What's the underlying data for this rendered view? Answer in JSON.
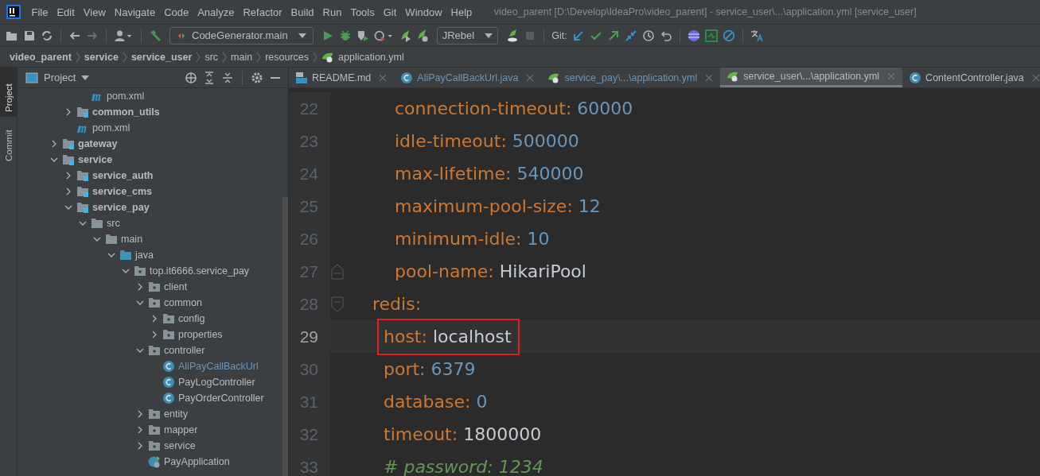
{
  "menu": [
    "File",
    "Edit",
    "View",
    "Navigate",
    "Code",
    "Analyze",
    "Refactor",
    "Build",
    "Run",
    "Tools",
    "Git",
    "Window",
    "Help"
  ],
  "window": {
    "title": "video_parent [D:\\Develop\\IdeaPro\\video_parent] - service_user\\...\\application.yml [service_user]"
  },
  "toolbar": {
    "run_config": "CodeGenerator.main",
    "jrebel": "JRebel",
    "git_label": "Git:"
  },
  "breadcrumb": [
    {
      "label": "video_parent",
      "bold": true,
      "kind": "folder"
    },
    {
      "label": "service",
      "bold": true,
      "kind": "folder"
    },
    {
      "label": "service_user",
      "bold": true,
      "kind": "folder"
    },
    {
      "label": "src",
      "bold": false,
      "kind": "folder"
    },
    {
      "label": "main",
      "bold": false,
      "kind": "folder"
    },
    {
      "label": "resources",
      "bold": false,
      "kind": "folder"
    },
    {
      "label": "application.yml",
      "bold": false,
      "kind": "yml"
    }
  ],
  "side_tabs": [
    {
      "label": "Project",
      "selected": true
    },
    {
      "label": "Commit",
      "selected": false
    }
  ],
  "project": {
    "title": "Project",
    "tree": {
      "deep_items": [
        {
          "label": "pom.xml",
          "kind": "maven",
          "bold": false
        }
      ],
      "module_items": [
        {
          "label": "common_utils",
          "kind": "module",
          "bold": true,
          "expanded": false
        },
        {
          "label": "pom.xml",
          "kind": "maven",
          "bold": false
        }
      ],
      "items": [
        {
          "label": "gateway",
          "kind": "module",
          "bold": true,
          "expanded": false
        },
        {
          "label": "service",
          "kind": "module",
          "bold": true,
          "expanded": true,
          "children": [
            {
              "label": "service_auth",
              "kind": "module",
              "bold": true,
              "expanded": false
            },
            {
              "label": "service_cms",
              "kind": "module",
              "bold": true,
              "expanded": false
            },
            {
              "label": "service_pay",
              "kind": "module",
              "bold": true,
              "expanded": true,
              "children": [
                {
                  "label": "src",
                  "kind": "folder",
                  "bold": false,
                  "expanded": true,
                  "children": [
                    {
                      "label": "main",
                      "kind": "folder",
                      "bold": false,
                      "expanded": true,
                      "children": [
                        {
                          "label": "java",
                          "kind": "source",
                          "bold": false,
                          "expanded": true,
                          "children": [
                            {
                              "label": "top.it6666.service_pay",
                              "kind": "package",
                              "bold": false,
                              "expanded": true,
                              "children": [
                                {
                                  "label": "client",
                                  "kind": "package",
                                  "bold": false,
                                  "expanded": false
                                },
                                {
                                  "label": "common",
                                  "kind": "package",
                                  "bold": false,
                                  "expanded": true,
                                  "children": [
                                    {
                                      "label": "config",
                                      "kind": "package",
                                      "bold": false,
                                      "expanded": false
                                    },
                                    {
                                      "label": "properties",
                                      "kind": "package",
                                      "bold": false,
                                      "expanded": false
                                    }
                                  ]
                                },
                                {
                                  "label": "controller",
                                  "kind": "package",
                                  "bold": false,
                                  "expanded": true,
                                  "children": [
                                    {
                                      "label": "AliPayCallBackUrl",
                                      "kind": "class",
                                      "bold": false,
                                      "modified": true
                                    },
                                    {
                                      "label": "PayLogController",
                                      "kind": "class",
                                      "bold": false,
                                      "modified": false
                                    },
                                    {
                                      "label": "PayOrderController",
                                      "kind": "class",
                                      "bold": false,
                                      "modified": false
                                    }
                                  ]
                                },
                                {
                                  "label": "entity",
                                  "kind": "package",
                                  "bold": false,
                                  "expanded": false
                                },
                                {
                                  "label": "mapper",
                                  "kind": "package",
                                  "bold": false,
                                  "expanded": false
                                },
                                {
                                  "label": "service",
                                  "kind": "package",
                                  "bold": false,
                                  "expanded": false
                                },
                                {
                                  "label": "PayApplication",
                                  "kind": "app",
                                  "bold": false,
                                  "modified": false
                                }
                              ]
                            }
                          ]
                        }
                      ]
                    }
                  ]
                }
              ]
            }
          ]
        }
      ]
    }
  },
  "tabs": [
    {
      "label": "README.md",
      "kind": "md",
      "selected": false,
      "modified": false
    },
    {
      "label": "AliPayCallBackUrl.java",
      "kind": "class",
      "selected": false,
      "modified": true
    },
    {
      "label": "service_pay\\...\\application.yml",
      "kind": "yml",
      "selected": false,
      "modified": true
    },
    {
      "label": "service_user\\...\\application.yml",
      "kind": "yml",
      "selected": true,
      "modified": false
    },
    {
      "label": "ContentController.java",
      "kind": "class",
      "selected": false,
      "modified": false
    }
  ],
  "editor": {
    "continued_lines": [
      {
        "number": "22",
        "kind": "number",
        "key": "connection-timeout:",
        "value": "60000",
        "current": false,
        "boxed": false,
        "fold_start": false,
        "fold_end": false
      },
      {
        "number": "23",
        "kind": "number",
        "key": "idle-timeout:",
        "value": "500000",
        "current": false,
        "boxed": false,
        "fold_start": false,
        "fold_end": false
      },
      {
        "number": "24",
        "kind": "number",
        "key": "max-lifetime:",
        "value": "540000",
        "current": false,
        "boxed": false,
        "fold_start": false,
        "fold_end": false
      },
      {
        "number": "25",
        "kind": "number",
        "key": "maximum-pool-size:",
        "value": "12",
        "current": false,
        "boxed": false,
        "fold_start": false,
        "fold_end": false
      },
      {
        "number": "26",
        "kind": "number",
        "key": "minimum-idle:",
        "value": "10",
        "current": false,
        "boxed": false,
        "fold_start": false,
        "fold_end": false
      },
      {
        "number": "27",
        "kind": "text",
        "key": "pool-name:",
        "value": "HikariPool",
        "current": false,
        "boxed": false,
        "fold_start": false,
        "fold_end": true
      }
    ],
    "lines": [
      {
        "number": "28",
        "kind": "section",
        "key": "redis:",
        "current": false,
        "boxed": false,
        "fold_start": true,
        "fold_end": false,
        "children": [
          {
            "number": "29",
            "kind": "text",
            "key": "host:",
            "value": "localhost",
            "current": true,
            "boxed": true,
            "fold_start": false,
            "fold_end": false
          },
          {
            "number": "30",
            "kind": "number",
            "key": "port:",
            "value": "6379",
            "current": false,
            "boxed": false,
            "fold_start": false,
            "fold_end": false
          },
          {
            "number": "31",
            "kind": "number",
            "key": "database:",
            "value": "0",
            "current": false,
            "boxed": false,
            "fold_start": false,
            "fold_end": false
          },
          {
            "number": "32",
            "kind": "text",
            "key": "timeout:",
            "value": "1800000",
            "current": false,
            "boxed": false,
            "fold_start": false,
            "fold_end": false
          },
          {
            "number": "33",
            "kind": "comment",
            "text": "# password: 1234",
            "current": false,
            "boxed": false,
            "fold_start": false,
            "fold_end": false
          }
        ]
      }
    ]
  }
}
